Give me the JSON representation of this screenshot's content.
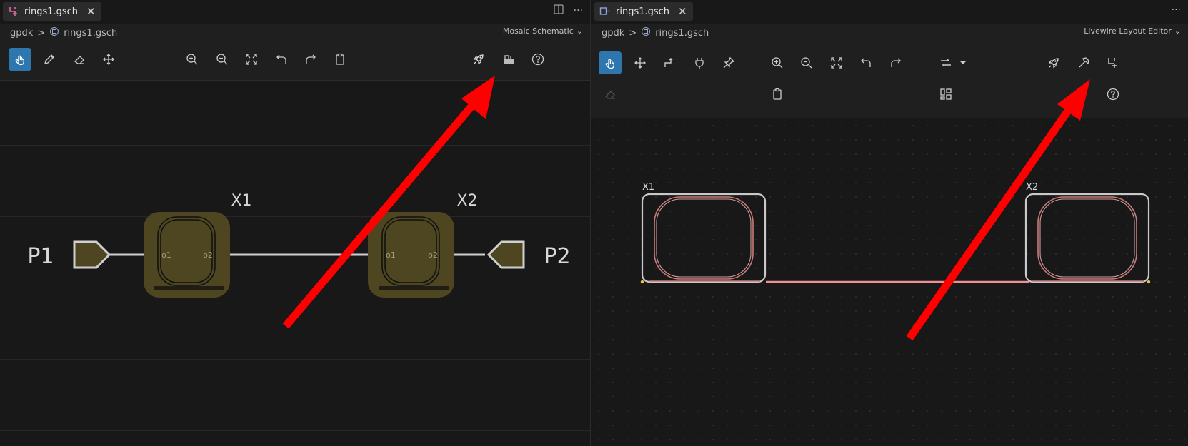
{
  "left": {
    "tab": {
      "title": "rings1.gsch",
      "close": "✕"
    },
    "tab_actions": {
      "more": "···"
    },
    "breadcrumb": {
      "root": "gpdk",
      "sep": ">",
      "file": "rings1.gsch"
    },
    "editor_select": {
      "label": "Mosaic Schematic",
      "chevron": "⌄"
    },
    "schematic": {
      "ports": [
        "P1",
        "P2"
      ],
      "instances": [
        {
          "name": "X1",
          "pins": [
            "o1",
            "o2"
          ]
        },
        {
          "name": "X2",
          "pins": [
            "o1",
            "o2"
          ]
        }
      ]
    }
  },
  "right": {
    "tab": {
      "title": "rings1.gsch",
      "close": "✕"
    },
    "tab_actions": {
      "more": "···"
    },
    "breadcrumb": {
      "root": "gpdk",
      "sep": ">",
      "file": "rings1.gsch"
    },
    "editor_select": {
      "label": "Livewire Layout Editor",
      "chevron": "⌄"
    },
    "layout": {
      "instances": [
        "X1",
        "X2"
      ]
    }
  },
  "colors": {
    "accent": "#2e77ae",
    "arrow": "#ff0000",
    "instance_fill": "#4d4620",
    "route": "#f09090"
  },
  "icons": {
    "left_toolbar": [
      "pointer-hand-icon",
      "pencil-icon",
      "eraser-icon",
      "move-icon",
      "zoom-in-icon",
      "zoom-out-icon",
      "fit-view-icon",
      "undo-icon",
      "redo-icon",
      "clipboard-icon",
      "rocket-icon",
      "build-icon",
      "help-icon"
    ],
    "right_toolbar": [
      "pointer-hand-icon",
      "move-icon",
      "route-icon",
      "plug-icon",
      "pin-icon",
      "eraser-icon",
      "zoom-in-icon",
      "zoom-out-icon",
      "fit-view-icon",
      "undo-icon",
      "redo-icon",
      "clipboard-icon",
      "route-settings-icon",
      "dropdown-icon",
      "components-icon",
      "rocket-icon",
      "hammer-icon",
      "schematic-icon",
      "help-icon"
    ]
  }
}
